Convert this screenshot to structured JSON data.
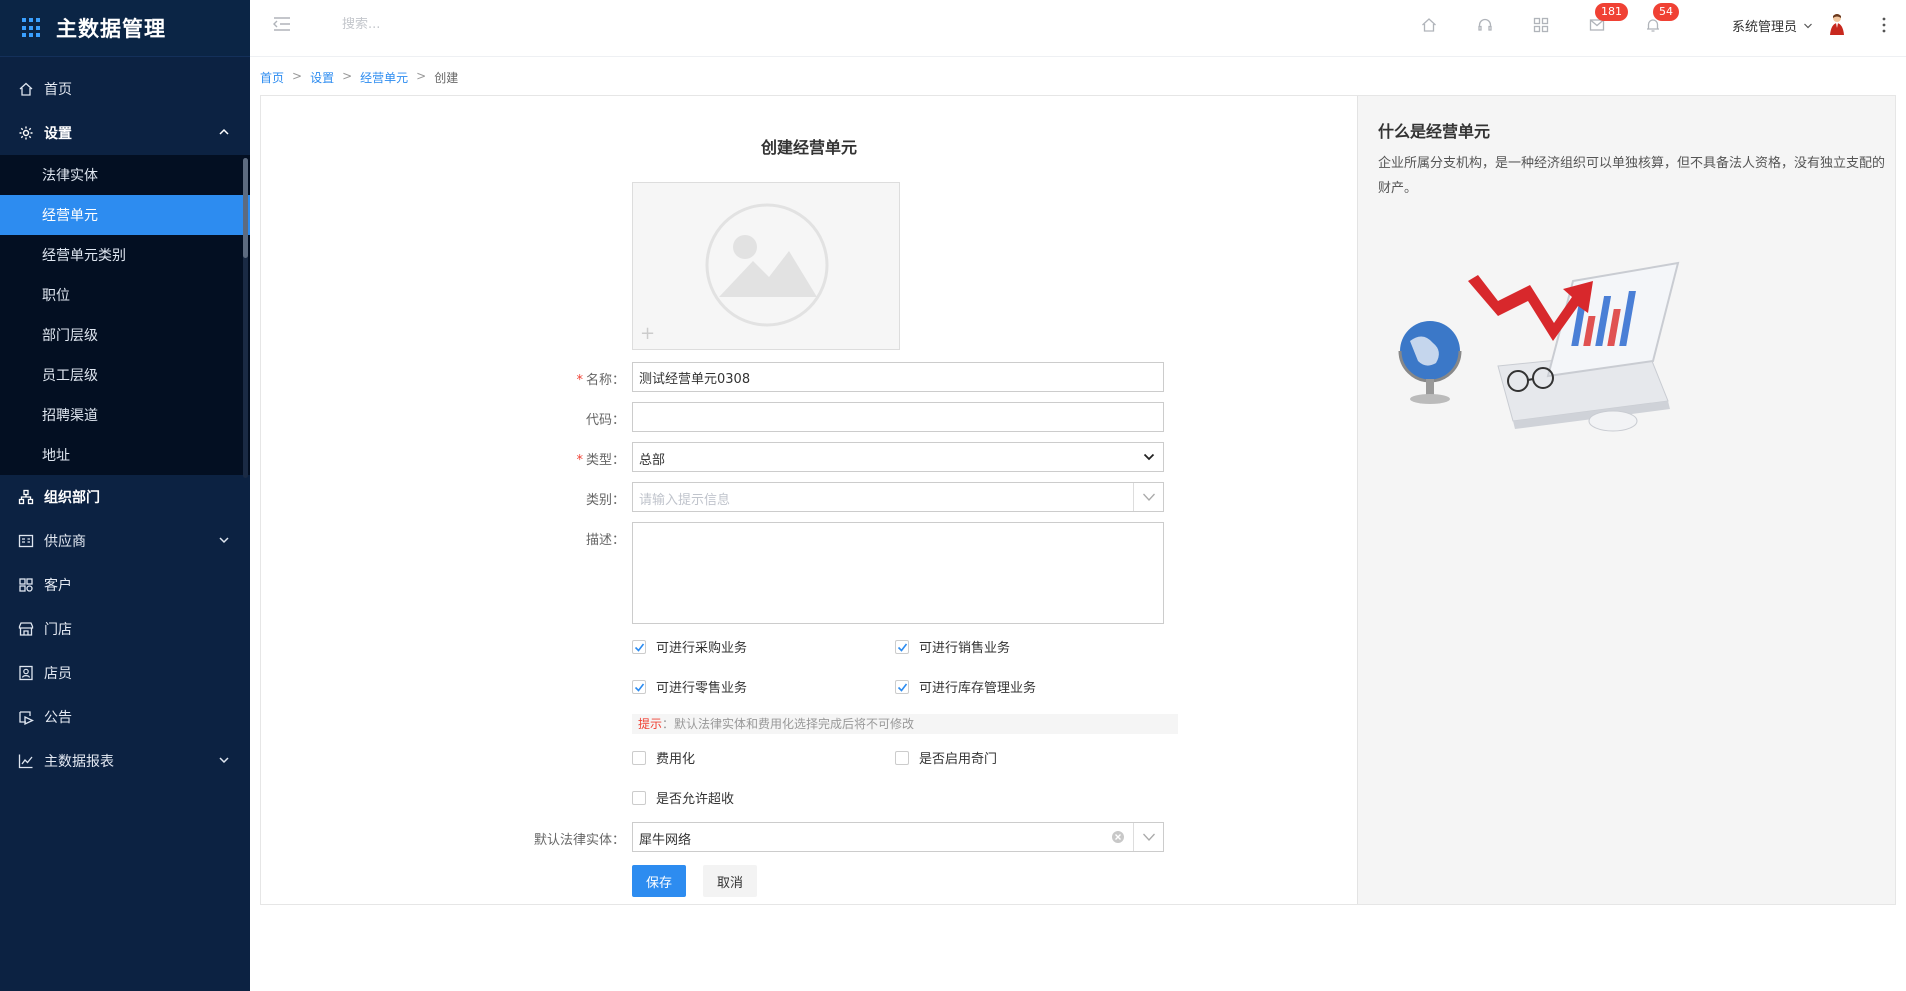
{
  "app": {
    "title": "主数据管理"
  },
  "colors": {
    "sidebar_bg": "#0c2242",
    "accent": "#2d8cf0",
    "danger": "#f04134"
  },
  "sidebar": {
    "items": [
      {
        "label": "首页",
        "icon": "home-icon"
      },
      {
        "label": "设置",
        "icon": "gear-icon",
        "expanded": true,
        "children": [
          "法律实体",
          "经营单元",
          "经营单元类别",
          "职位",
          "部门层级",
          "员工层级",
          "招聘渠道",
          "地址"
        ],
        "active_child": "经营单元"
      },
      {
        "label": "组织部门",
        "icon": "org-icon"
      },
      {
        "label": "供应商",
        "icon": "supplier-icon"
      },
      {
        "label": "客户",
        "icon": "customer-icon"
      },
      {
        "label": "门店",
        "icon": "store-icon"
      },
      {
        "label": "店员",
        "icon": "clerk-icon"
      },
      {
        "label": "公告",
        "icon": "notice-icon"
      },
      {
        "label": "主数据报表",
        "icon": "report-icon"
      }
    ]
  },
  "header": {
    "search_placeholder": "搜索...",
    "mail_badge": "181",
    "bell_badge": "54",
    "user_name": "系统管理员"
  },
  "breadcrumb": [
    "首页",
    "设置",
    "经营单元",
    "创建"
  ],
  "form": {
    "title": "创建经营单元",
    "name_label": "名称：",
    "name_value": "测试经营单元0308",
    "code_label": "代码：",
    "code_value": "",
    "type_label": "类型：",
    "type_value": "总部",
    "category_label": "类别：",
    "category_placeholder": "请输入提示信息",
    "desc_label": "描述：",
    "desc_value": "",
    "checks": [
      {
        "label": "可进行采购业务",
        "checked": true
      },
      {
        "label": "可进行销售业务",
        "checked": true
      },
      {
        "label": "可进行零售业务",
        "checked": true
      },
      {
        "label": "可进行库存管理业务",
        "checked": true
      },
      {
        "label": "费用化",
        "checked": false
      },
      {
        "label": "是否启用奇门",
        "checked": false
      },
      {
        "label": "是否允许超收",
        "checked": false
      }
    ],
    "tip_key": "提示",
    "tip_text": "：默认法律实体和费用化选择完成后将不可修改",
    "legal_label": "默认法律实体：",
    "legal_value": "犀牛网络",
    "save": "保存",
    "cancel": "取消"
  },
  "info": {
    "title": "什么是经营单元",
    "description": "企业所属分支机构，是一种经济组织可以单独核算，但不具备法人资格，没有独立支配的财产。"
  }
}
